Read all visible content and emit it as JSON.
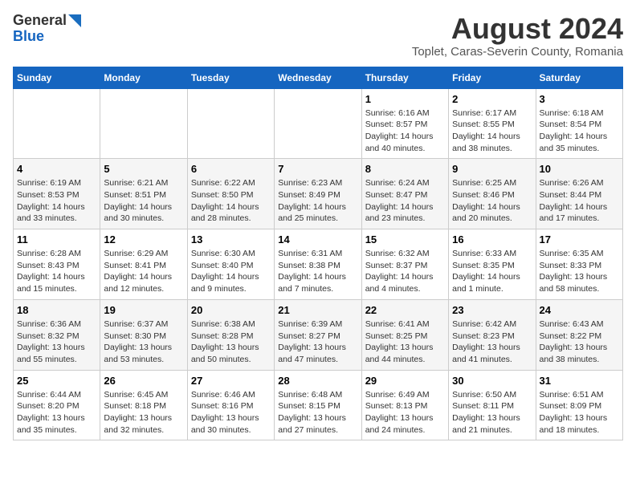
{
  "header": {
    "logo_general": "General",
    "logo_blue": "Blue",
    "main_title": "August 2024",
    "subtitle": "Toplet, Caras-Severin County, Romania"
  },
  "days_of_week": [
    "Sunday",
    "Monday",
    "Tuesday",
    "Wednesday",
    "Thursday",
    "Friday",
    "Saturday"
  ],
  "weeks": [
    [
      {
        "day": "",
        "info": ""
      },
      {
        "day": "",
        "info": ""
      },
      {
        "day": "",
        "info": ""
      },
      {
        "day": "",
        "info": ""
      },
      {
        "day": "1",
        "info": "Sunrise: 6:16 AM\nSunset: 8:57 PM\nDaylight: 14 hours and 40 minutes."
      },
      {
        "day": "2",
        "info": "Sunrise: 6:17 AM\nSunset: 8:55 PM\nDaylight: 14 hours and 38 minutes."
      },
      {
        "day": "3",
        "info": "Sunrise: 6:18 AM\nSunset: 8:54 PM\nDaylight: 14 hours and 35 minutes."
      }
    ],
    [
      {
        "day": "4",
        "info": "Sunrise: 6:19 AM\nSunset: 8:53 PM\nDaylight: 14 hours and 33 minutes."
      },
      {
        "day": "5",
        "info": "Sunrise: 6:21 AM\nSunset: 8:51 PM\nDaylight: 14 hours and 30 minutes."
      },
      {
        "day": "6",
        "info": "Sunrise: 6:22 AM\nSunset: 8:50 PM\nDaylight: 14 hours and 28 minutes."
      },
      {
        "day": "7",
        "info": "Sunrise: 6:23 AM\nSunset: 8:49 PM\nDaylight: 14 hours and 25 minutes."
      },
      {
        "day": "8",
        "info": "Sunrise: 6:24 AM\nSunset: 8:47 PM\nDaylight: 14 hours and 23 minutes."
      },
      {
        "day": "9",
        "info": "Sunrise: 6:25 AM\nSunset: 8:46 PM\nDaylight: 14 hours and 20 minutes."
      },
      {
        "day": "10",
        "info": "Sunrise: 6:26 AM\nSunset: 8:44 PM\nDaylight: 14 hours and 17 minutes."
      }
    ],
    [
      {
        "day": "11",
        "info": "Sunrise: 6:28 AM\nSunset: 8:43 PM\nDaylight: 14 hours and 15 minutes."
      },
      {
        "day": "12",
        "info": "Sunrise: 6:29 AM\nSunset: 8:41 PM\nDaylight: 14 hours and 12 minutes."
      },
      {
        "day": "13",
        "info": "Sunrise: 6:30 AM\nSunset: 8:40 PM\nDaylight: 14 hours and 9 minutes."
      },
      {
        "day": "14",
        "info": "Sunrise: 6:31 AM\nSunset: 8:38 PM\nDaylight: 14 hours and 7 minutes."
      },
      {
        "day": "15",
        "info": "Sunrise: 6:32 AM\nSunset: 8:37 PM\nDaylight: 14 hours and 4 minutes."
      },
      {
        "day": "16",
        "info": "Sunrise: 6:33 AM\nSunset: 8:35 PM\nDaylight: 14 hours and 1 minute."
      },
      {
        "day": "17",
        "info": "Sunrise: 6:35 AM\nSunset: 8:33 PM\nDaylight: 13 hours and 58 minutes."
      }
    ],
    [
      {
        "day": "18",
        "info": "Sunrise: 6:36 AM\nSunset: 8:32 PM\nDaylight: 13 hours and 55 minutes."
      },
      {
        "day": "19",
        "info": "Sunrise: 6:37 AM\nSunset: 8:30 PM\nDaylight: 13 hours and 53 minutes."
      },
      {
        "day": "20",
        "info": "Sunrise: 6:38 AM\nSunset: 8:28 PM\nDaylight: 13 hours and 50 minutes."
      },
      {
        "day": "21",
        "info": "Sunrise: 6:39 AM\nSunset: 8:27 PM\nDaylight: 13 hours and 47 minutes."
      },
      {
        "day": "22",
        "info": "Sunrise: 6:41 AM\nSunset: 8:25 PM\nDaylight: 13 hours and 44 minutes."
      },
      {
        "day": "23",
        "info": "Sunrise: 6:42 AM\nSunset: 8:23 PM\nDaylight: 13 hours and 41 minutes."
      },
      {
        "day": "24",
        "info": "Sunrise: 6:43 AM\nSunset: 8:22 PM\nDaylight: 13 hours and 38 minutes."
      }
    ],
    [
      {
        "day": "25",
        "info": "Sunrise: 6:44 AM\nSunset: 8:20 PM\nDaylight: 13 hours and 35 minutes."
      },
      {
        "day": "26",
        "info": "Sunrise: 6:45 AM\nSunset: 8:18 PM\nDaylight: 13 hours and 32 minutes."
      },
      {
        "day": "27",
        "info": "Sunrise: 6:46 AM\nSunset: 8:16 PM\nDaylight: 13 hours and 30 minutes."
      },
      {
        "day": "28",
        "info": "Sunrise: 6:48 AM\nSunset: 8:15 PM\nDaylight: 13 hours and 27 minutes."
      },
      {
        "day": "29",
        "info": "Sunrise: 6:49 AM\nSunset: 8:13 PM\nDaylight: 13 hours and 24 minutes."
      },
      {
        "day": "30",
        "info": "Sunrise: 6:50 AM\nSunset: 8:11 PM\nDaylight: 13 hours and 21 minutes."
      },
      {
        "day": "31",
        "info": "Sunrise: 6:51 AM\nSunset: 8:09 PM\nDaylight: 13 hours and 18 minutes."
      }
    ]
  ]
}
